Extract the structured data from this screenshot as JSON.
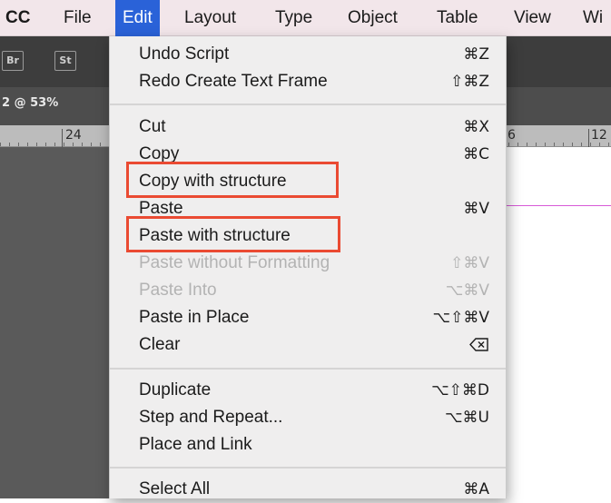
{
  "menubar": {
    "app": "CC",
    "items": [
      {
        "label": "File"
      },
      {
        "label": "Edit"
      },
      {
        "label": "Layout"
      },
      {
        "label": "Type"
      },
      {
        "label": "Object"
      },
      {
        "label": "Table"
      },
      {
        "label": "View"
      },
      {
        "label": "Wi"
      }
    ]
  },
  "background": {
    "tool_buttons": [
      "Br",
      "St"
    ],
    "doc_tab": "2 @ 53%",
    "ruler_numbers": [
      "24",
      "6",
      "12"
    ]
  },
  "menu": {
    "items": [
      {
        "label": "Undo Script",
        "shortcut": "⌘Z"
      },
      {
        "label": "Redo Create Text Frame",
        "shortcut": "⇧⌘Z"
      },
      {
        "label": "Cut",
        "shortcut": "⌘X"
      },
      {
        "label": "Copy",
        "shortcut": "⌘C"
      },
      {
        "label": "Copy with structure",
        "shortcut": ""
      },
      {
        "label": "Paste",
        "shortcut": "⌘V"
      },
      {
        "label": "Paste with structure",
        "shortcut": ""
      },
      {
        "label": "Paste without Formatting",
        "shortcut": "⇧⌘V"
      },
      {
        "label": "Paste Into",
        "shortcut": "⌥⌘V"
      },
      {
        "label": "Paste in Place",
        "shortcut": "⌥⇧⌘V"
      },
      {
        "label": "Clear",
        "shortcut": ""
      },
      {
        "label": "Duplicate",
        "shortcut": "⌥⇧⌘D"
      },
      {
        "label": "Step and Repeat...",
        "shortcut": "⌥⌘U"
      },
      {
        "label": "Place and Link",
        "shortcut": ""
      },
      {
        "label": "Select All",
        "shortcut": "⌘A"
      }
    ]
  },
  "colors": {
    "menu_active": "#2a62d8",
    "highlight_box": "#ea4a32",
    "disabled_text": "#b3b3b3"
  }
}
